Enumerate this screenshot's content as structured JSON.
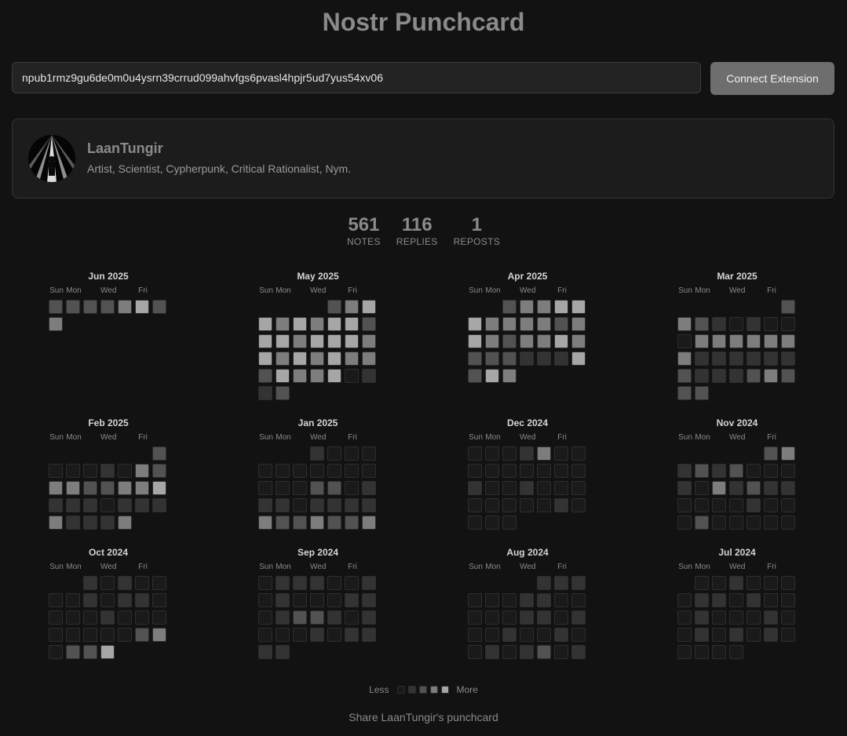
{
  "title": "Nostr Punchcard",
  "npub_input": {
    "value": "npub1rmz9gu6de0m0u4ysrn39crrud099ahvfgs6pvasl4hpjr5ud7yus54xv06"
  },
  "connect_button": {
    "label": "Connect Extension"
  },
  "profile": {
    "name": "LaanTungir",
    "about": "Artist, Scientist, Cypherpunk, Critical Rationalist, Nym."
  },
  "stats": [
    {
      "value": "561",
      "label": "NOTES"
    },
    {
      "value": "116",
      "label": "REPLIES"
    },
    {
      "value": "1",
      "label": "REPOSTS"
    }
  ],
  "day_labels": [
    "Sun",
    "Mon",
    "Wed",
    "Fri"
  ],
  "activity_colors": [
    "#1a1a1a",
    "#333333",
    "#525252",
    "#7d7d7d",
    "#a6a6a6"
  ],
  "months": [
    {
      "name": "Jun 2025",
      "start": 0,
      "levels": [
        2,
        2,
        2,
        2,
        3,
        4,
        2,
        3
      ]
    },
    {
      "name": "May 2025",
      "start": 4,
      "levels": [
        2,
        3,
        4,
        4,
        3,
        4,
        3,
        4,
        4,
        2,
        4,
        4,
        3,
        4,
        4,
        4,
        3,
        4,
        3,
        4,
        3,
        4,
        3,
        3,
        2,
        4,
        3,
        3,
        4,
        0,
        1,
        1,
        2
      ]
    },
    {
      "name": "Apr 2025",
      "start": 2,
      "levels": [
        2,
        3,
        3,
        4,
        4,
        4,
        3,
        3,
        3,
        3,
        2,
        3,
        4,
        3,
        2,
        3,
        3,
        4,
        3,
        2,
        2,
        2,
        1,
        1,
        1,
        4,
        2,
        4,
        3
      ]
    },
    {
      "name": "Mar 2025",
      "start": 6,
      "levels": [
        2,
        3,
        2,
        1,
        0,
        1,
        0,
        0,
        0,
        3,
        3,
        3,
        3,
        3,
        3,
        3,
        1,
        1,
        1,
        1,
        1,
        1,
        2,
        1,
        1,
        1,
        2,
        3,
        2,
        2,
        2
      ]
    },
    {
      "name": "Feb 2025",
      "start": 6,
      "levels": [
        2,
        0,
        0,
        0,
        1,
        0,
        3,
        2,
        3,
        3,
        2,
        2,
        3,
        3,
        4,
        1,
        1,
        1,
        0,
        1,
        1,
        1,
        3,
        1,
        1,
        1,
        3
      ]
    },
    {
      "name": "Jan 2025",
      "start": 3,
      "levels": [
        1,
        0,
        0,
        0,
        0,
        0,
        0,
        0,
        0,
        0,
        0,
        0,
        0,
        0,
        2,
        2,
        0,
        1,
        1,
        1,
        0,
        1,
        1,
        1,
        1,
        3,
        2,
        2,
        3,
        2,
        2,
        3
      ]
    },
    {
      "name": "Dec 2024",
      "start": 0,
      "levels": [
        0,
        0,
        0,
        1,
        3,
        0,
        0,
        0,
        0,
        0,
        0,
        0,
        0,
        0,
        1,
        0,
        0,
        1,
        0,
        0,
        0,
        0,
        0,
        0,
        0,
        0,
        1,
        0,
        0,
        0,
        0
      ]
    },
    {
      "name": "Nov 2024",
      "start": 5,
      "levels": [
        2,
        3,
        1,
        2,
        1,
        2,
        0,
        0,
        0,
        1,
        0,
        3,
        1,
        2,
        1,
        1,
        0,
        0,
        0,
        0,
        1,
        0,
        0,
        0,
        2,
        0,
        0,
        0,
        0,
        0
      ]
    },
    {
      "name": "Oct 2024",
      "start": 2,
      "levels": [
        1,
        0,
        1,
        0,
        0,
        0,
        0,
        1,
        0,
        1,
        1,
        0,
        0,
        0,
        0,
        1,
        0,
        0,
        0,
        0,
        0,
        0,
        0,
        0,
        2,
        3,
        0,
        2,
        2,
        4
      ]
    },
    {
      "name": "Sep 2024",
      "start": 0,
      "levels": [
        0,
        1,
        1,
        1,
        0,
        0,
        1,
        0,
        1,
        0,
        0,
        0,
        1,
        1,
        0,
        1,
        2,
        2,
        1,
        0,
        1,
        0,
        0,
        0,
        1,
        0,
        1,
        1,
        1,
        1
      ]
    },
    {
      "name": "Aug 2024",
      "start": 4,
      "levels": [
        1,
        1,
        1,
        0,
        0,
        0,
        1,
        1,
        0,
        0,
        0,
        0,
        0,
        1,
        1,
        0,
        1,
        0,
        0,
        1,
        0,
        0,
        1,
        0,
        0,
        1,
        0,
        1,
        2,
        0,
        1
      ]
    },
    {
      "name": "Jul 2024",
      "start": 1,
      "levels": [
        0,
        0,
        1,
        0,
        0,
        0,
        0,
        1,
        1,
        0,
        1,
        0,
        0,
        0,
        1,
        0,
        0,
        0,
        1,
        0,
        0,
        1,
        0,
        1,
        0,
        1,
        0,
        0,
        0,
        0,
        0
      ]
    }
  ],
  "legend": {
    "less": "Less",
    "more": "More"
  },
  "share_text": "Share LaanTungir's punchcard"
}
